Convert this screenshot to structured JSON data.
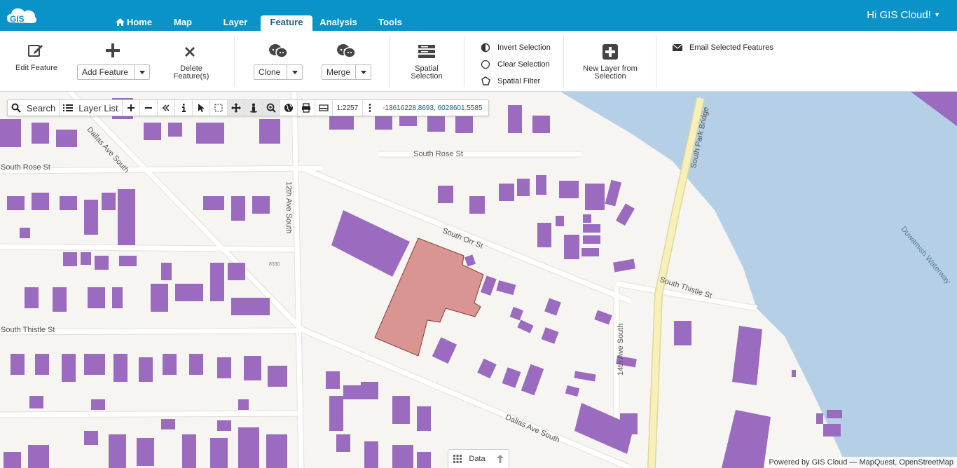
{
  "app": {
    "logo_text": "GIS",
    "user_greeting": "Hi GIS Cloud!"
  },
  "nav": {
    "tabs": [
      {
        "label": "Home",
        "icon": "home-icon"
      },
      {
        "label": "Map"
      },
      {
        "label": "Layer"
      },
      {
        "label": "Feature",
        "active": true
      },
      {
        "label": "Analysis"
      },
      {
        "label": "Tools"
      }
    ]
  },
  "ribbon": {
    "edit_feature": "Edit Feature",
    "add_feature": "Add Feature",
    "delete_feature_line1": "Delete",
    "delete_feature_line2": "Feature(s)",
    "clone": "Clone",
    "merge": "Merge",
    "spatial_selection_line1": "Spatial",
    "spatial_selection_line2": "Selection",
    "invert_selection": "Invert Selection",
    "clear_selection": "Clear Selection",
    "spatial_filter": "Spatial Filter",
    "new_layer_line1": "New Layer from",
    "new_layer_line2": "Selection",
    "email_selected": "Email Selected Features"
  },
  "map_toolbar": {
    "search_label": "Search",
    "layer_list_label": "Layer List",
    "scale": "1:2257",
    "coordinates": "-13616228.8693, 6028601.5585"
  },
  "map": {
    "streets": {
      "south_rose_st_left": "South Rose St",
      "south_rose_st_right": "South Rose St",
      "south_thistle_st_left": "South Thistle St",
      "south_thistle_st_right": "South Thistle St",
      "south_orr_st": "South Orr St",
      "dallas_ave_south_top": "Dallas Ave South",
      "dallas_ave_south_bottom": "Dallas Ave South",
      "twelfth_ave_south": "12th Ave South",
      "fourteenth_ave_south": "14th Ave South",
      "south_park_bridge": "South Park Bridge",
      "duwamish_waterway": "Duwamish Waterway",
      "address_8330": "8330"
    },
    "colors": {
      "building": "#9b6bbf",
      "selected": "#d99591",
      "water": "#b5d0e6",
      "road": "#ffffff",
      "background": "#f7f5f2",
      "major_road": "#f7f0b9"
    }
  },
  "data_tab": {
    "label": "Data"
  },
  "attribution": "Powered by GIS Cloud — MapQuest, OpenStreetMap"
}
